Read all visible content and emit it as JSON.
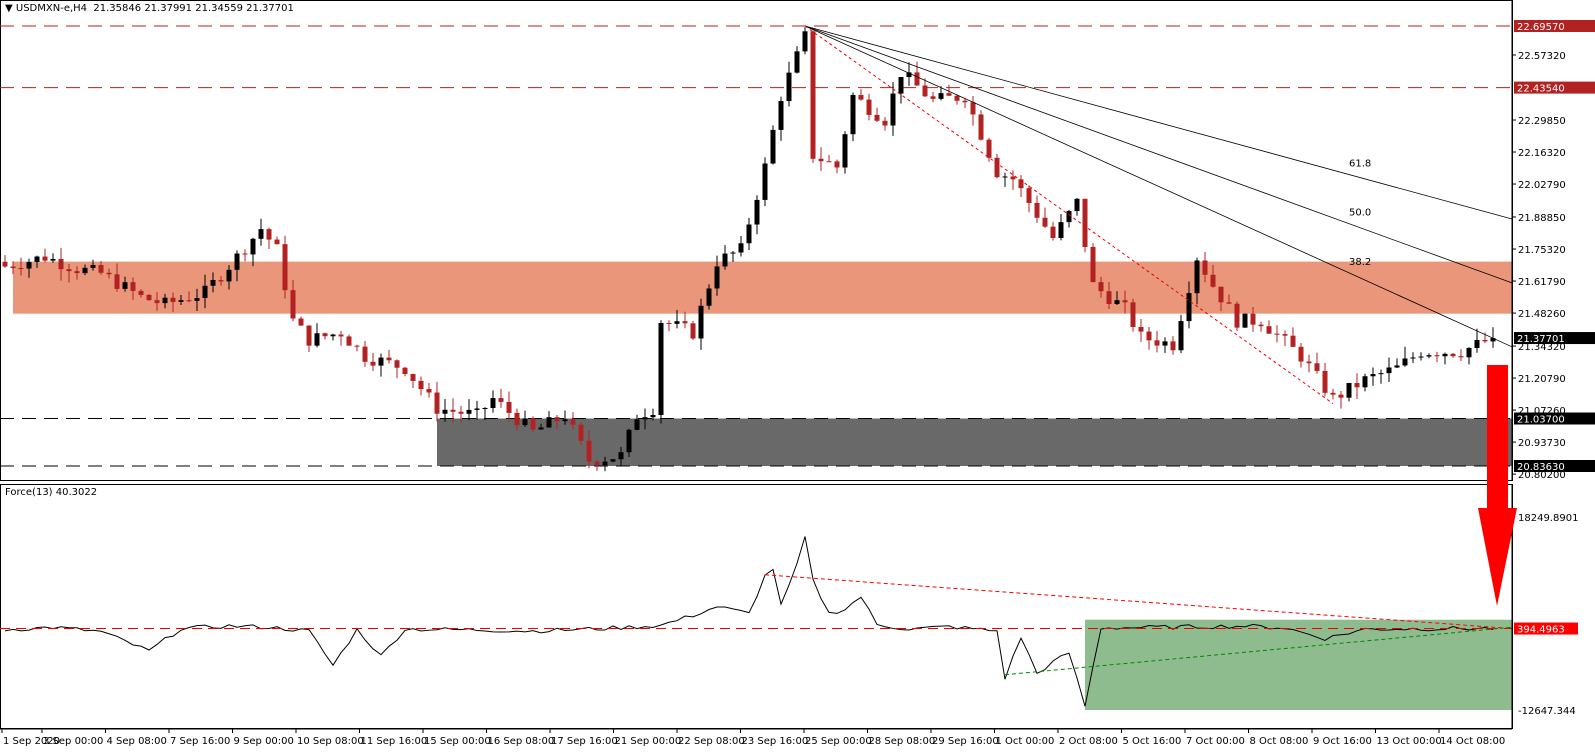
{
  "header": {
    "symbol": "USDMXN-e,H4",
    "open": "21.35846",
    "high": "21.37991",
    "low": "21.34559",
    "close": "21.37701",
    "menu_icon": "triangle-down-icon"
  },
  "indicator": {
    "name": "Force(13)",
    "value": "40.3022"
  },
  "colors": {
    "bull": "#000000",
    "bear": "#b22222",
    "resistance_zone": "#e9967a",
    "support_zone": "#696969",
    "force_zone": "#8fbc8f",
    "arrow": "#ff0000",
    "level_red": "#b22222"
  },
  "chart_data": [
    {
      "type": "candlestick",
      "title": "USDMXN-e,H4",
      "ylim": [
        20.802,
        22.7476
      ],
      "bars_count": 187,
      "close_waypoints": [
        [
          0,
          21.68
        ],
        [
          5,
          21.72
        ],
        [
          9,
          21.67
        ],
        [
          12,
          21.65
        ],
        [
          17,
          21.55
        ],
        [
          20,
          21.52
        ],
        [
          25,
          21.57
        ],
        [
          29,
          21.72
        ],
        [
          32,
          21.84
        ],
        [
          34,
          21.75
        ],
        [
          36,
          21.45
        ],
        [
          38,
          21.37
        ],
        [
          42,
          21.4
        ],
        [
          45,
          21.3
        ],
        [
          50,
          21.25
        ],
        [
          54,
          21.08
        ],
        [
          59,
          21.05
        ],
        [
          61,
          21.12
        ],
        [
          66,
          20.98
        ],
        [
          70,
          21.05
        ],
        [
          73,
          20.86
        ],
        [
          77,
          20.88
        ],
        [
          79,
          21.05
        ],
        [
          81,
          21.08
        ],
        [
          82,
          21.45
        ],
        [
          86,
          21.4
        ],
        [
          89,
          21.7
        ],
        [
          92,
          21.75
        ],
        [
          95,
          22.1
        ],
        [
          97,
          22.4
        ],
        [
          100,
          22.65
        ],
        [
          101,
          22.15
        ],
        [
          104,
          22.1
        ],
        [
          106,
          22.4
        ],
        [
          110,
          22.3
        ],
        [
          112,
          22.5
        ],
        [
          116,
          22.38
        ],
        [
          120,
          22.4
        ],
        [
          124,
          22.08
        ],
        [
          126,
          22.05
        ],
        [
          131,
          21.8
        ],
        [
          134,
          21.95
        ],
        [
          136,
          21.6
        ],
        [
          140,
          21.5
        ],
        [
          142,
          21.38
        ],
        [
          146,
          21.35
        ],
        [
          149,
          21.72
        ],
        [
          151,
          21.6
        ],
        [
          154,
          21.45
        ],
        [
          157,
          21.45
        ],
        [
          162,
          21.3
        ],
        [
          166,
          21.12
        ],
        [
          170,
          21.2
        ],
        [
          174,
          21.25
        ],
        [
          177,
          21.32
        ],
        [
          182,
          21.32
        ],
        [
          186,
          21.37701
        ]
      ],
      "price_axis": {
        "ticks": [
          "22.57320",
          "22.29850",
          "22.16320",
          "22.02790",
          "21.88850",
          "21.75320",
          "21.61790",
          "21.48260",
          "21.34320",
          "21.20790",
          "21.07260",
          "20.93730",
          "20.80200"
        ],
        "tick_values": [
          22.5732,
          22.2985,
          22.1632,
          22.0279,
          21.8885,
          21.7532,
          21.6179,
          21.4826,
          21.3432,
          21.2079,
          21.0726,
          20.9373,
          20.802
        ],
        "levels": [
          {
            "label": "22.69570",
            "value": 22.6957,
            "style": "red"
          },
          {
            "label": "22.43540",
            "value": 22.4354,
            "style": "red"
          },
          {
            "label": "21.03700",
            "value": 21.037,
            "style": "black"
          },
          {
            "label": "20.83630",
            "value": 20.8363,
            "style": "black"
          }
        ],
        "current": {
          "label": "21.37701",
          "value": 21.37701
        }
      },
      "zones": [
        {
          "name": "resistance",
          "from": 21.48,
          "to": 21.7,
          "start_bar": 1
        },
        {
          "name": "support",
          "from": 20.8363,
          "to": 21.037,
          "start_bar": 54
        }
      ],
      "fib_fan": {
        "origin_bar": 100,
        "origin_price": 22.6957,
        "labels": [
          "38.2",
          "50.0",
          "61.8"
        ],
        "end_prices": [
          21.34,
          21.61,
          21.88
        ],
        "label_bar": 168
      },
      "red_trend": {
        "from_bar": 100,
        "from_price": 22.6957,
        "to_bar": 166,
        "to_price": 21.1
      }
    },
    {
      "type": "line",
      "title": "Force(13)",
      "ylim": [
        -12647.344,
        18249.8901
      ],
      "axis_labels": [
        "18249.8901",
        "-12647.344"
      ],
      "level": {
        "label": "394.4963",
        "value": 394.4963
      },
      "waypoints": [
        [
          0,
          200
        ],
        [
          6,
          600
        ],
        [
          12,
          -100
        ],
        [
          18,
          -3200
        ],
        [
          22,
          400
        ],
        [
          28,
          800
        ],
        [
          33,
          600
        ],
        [
          38,
          0
        ],
        [
          41,
          -5500
        ],
        [
          44,
          200
        ],
        [
          47,
          -4000
        ],
        [
          50,
          300
        ],
        [
          58,
          200
        ],
        [
          66,
          0
        ],
        [
          75,
          400
        ],
        [
          82,
          900
        ],
        [
          86,
          2500
        ],
        [
          89,
          3900
        ],
        [
          93,
          2800
        ],
        [
          95,
          8800
        ],
        [
          96,
          10000
        ],
        [
          97,
          4000
        ],
        [
          99,
          10500
        ],
        [
          100,
          15000
        ],
        [
          101,
          8000
        ],
        [
          103,
          2800
        ],
        [
          105,
          3500
        ],
        [
          107,
          5500
        ],
        [
          109,
          1000
        ],
        [
          113,
          300
        ],
        [
          118,
          700
        ],
        [
          124,
          0
        ],
        [
          125,
          -7500
        ],
        [
          127,
          -1000
        ],
        [
          129,
          -6800
        ],
        [
          131,
          -5000
        ],
        [
          133,
          -3500
        ],
        [
          135,
          -12000
        ],
        [
          137,
          500
        ],
        [
          145,
          600
        ],
        [
          155,
          800
        ],
        [
          160,
          500
        ],
        [
          165,
          -1200
        ],
        [
          170,
          300
        ],
        [
          180,
          400
        ],
        [
          186,
          394
        ]
      ],
      "zone": {
        "from": -12647.344,
        "to": 1800,
        "start_bar": 135
      },
      "red_trend": {
        "from_bar": 95,
        "from_value": 9000,
        "to_value": 394
      },
      "green_trend": {
        "from_bar": 125,
        "from_value": -7000,
        "to_value": 600
      }
    }
  ],
  "time_axis": [
    "1 Sep 2020",
    "3 Sep 00:00",
    "4 Sep 08:00",
    "7 Sep 16:00",
    "9 Sep 00:00",
    "10 Sep 08:00",
    "11 Sep 16:00",
    "15 Sep 00:00",
    "16 Sep 08:00",
    "17 Sep 16:00",
    "21 Sep 00:00",
    "22 Sep 08:00",
    "23 Sep 16:00",
    "25 Sep 00:00",
    "28 Sep 08:00",
    "29 Sep 16:00",
    "1 Oct 00:00",
    "2 Oct 08:00",
    "5 Oct 16:00",
    "7 Oct 00:00",
    "8 Oct 08:00",
    "9 Oct 16:00",
    "13 Oct 00:00",
    "14 Oct 08:00"
  ],
  "annotation": {
    "arrow": "down-arrow-icon"
  }
}
